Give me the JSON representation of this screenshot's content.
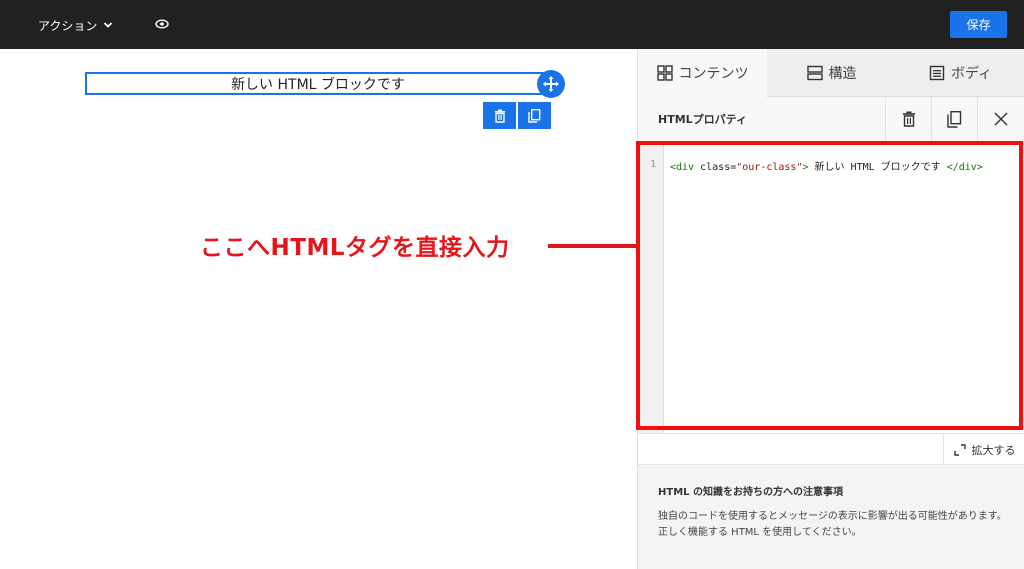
{
  "topbar": {
    "action_label": "アクション",
    "save_label": "保存",
    "accent_color": "#1a73e8"
  },
  "canvas": {
    "block_text": "新しい HTML ブロックです"
  },
  "annotation": {
    "text": "ここへHTMLタグを直接入力",
    "color": "#e8141a"
  },
  "panel": {
    "tabs": [
      {
        "label": "コンテンツ",
        "icon": "grid-icon"
      },
      {
        "label": "構造",
        "icon": "rows-icon"
      },
      {
        "label": "ボディ",
        "icon": "document-icon"
      }
    ],
    "properties_title": "HTMLプロパティ",
    "editor": {
      "line_number": "1",
      "code_open_tag": "<div",
      "code_attr": " class=",
      "code_attr_value": "\"our-class\"",
      "code_close_bracket": ">",
      "code_text": " 新しい HTML ブロックです ",
      "code_end_tag": "</div>"
    },
    "expand_label": "拡大する",
    "note_title": "HTML の知識をお持ちの方への注意事項",
    "note_body": "独自のコードを使用するとメッセージの表示に影響が出る可能性があります。正しく機能する HTML を使用してください。"
  }
}
